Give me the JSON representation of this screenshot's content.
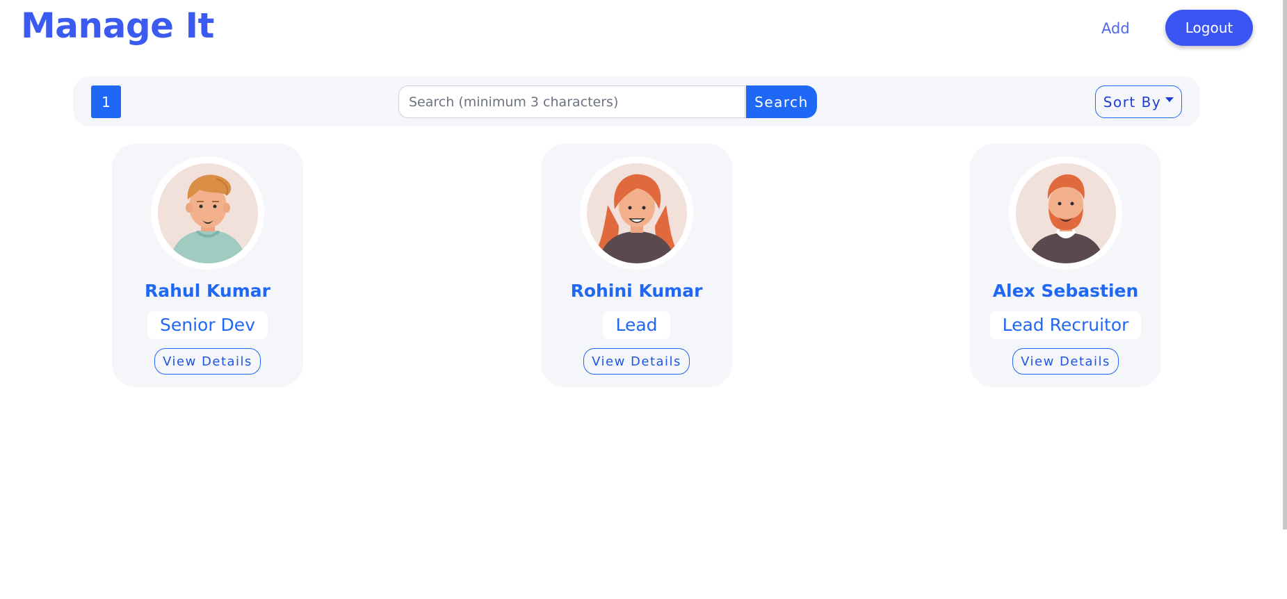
{
  "header": {
    "brand": "Manage It",
    "add_label": "Add",
    "logout_label": "Logout"
  },
  "toolbar": {
    "page_number": "1",
    "search_placeholder": "Search (minimum 3 characters)",
    "search_value": "",
    "search_label": "Search",
    "sort_label": "Sort By"
  },
  "employees": [
    {
      "name": "Rahul Kumar",
      "role": "Senior Dev",
      "action_label": "View Details",
      "avatar": "young-man-avatar"
    },
    {
      "name": "Rohini Kumar",
      "role": "Lead",
      "action_label": "View Details",
      "avatar": "red-haired-woman-avatar"
    },
    {
      "name": "Alex Sebastien",
      "role": "Lead Recruitor",
      "action_label": "View Details",
      "avatar": "bearded-man-avatar"
    }
  ],
  "colors": {
    "brand": "#3b5bf0",
    "primary": "#1f67f5",
    "logout": "#3b55f5",
    "panel": "#f5f6fa"
  }
}
